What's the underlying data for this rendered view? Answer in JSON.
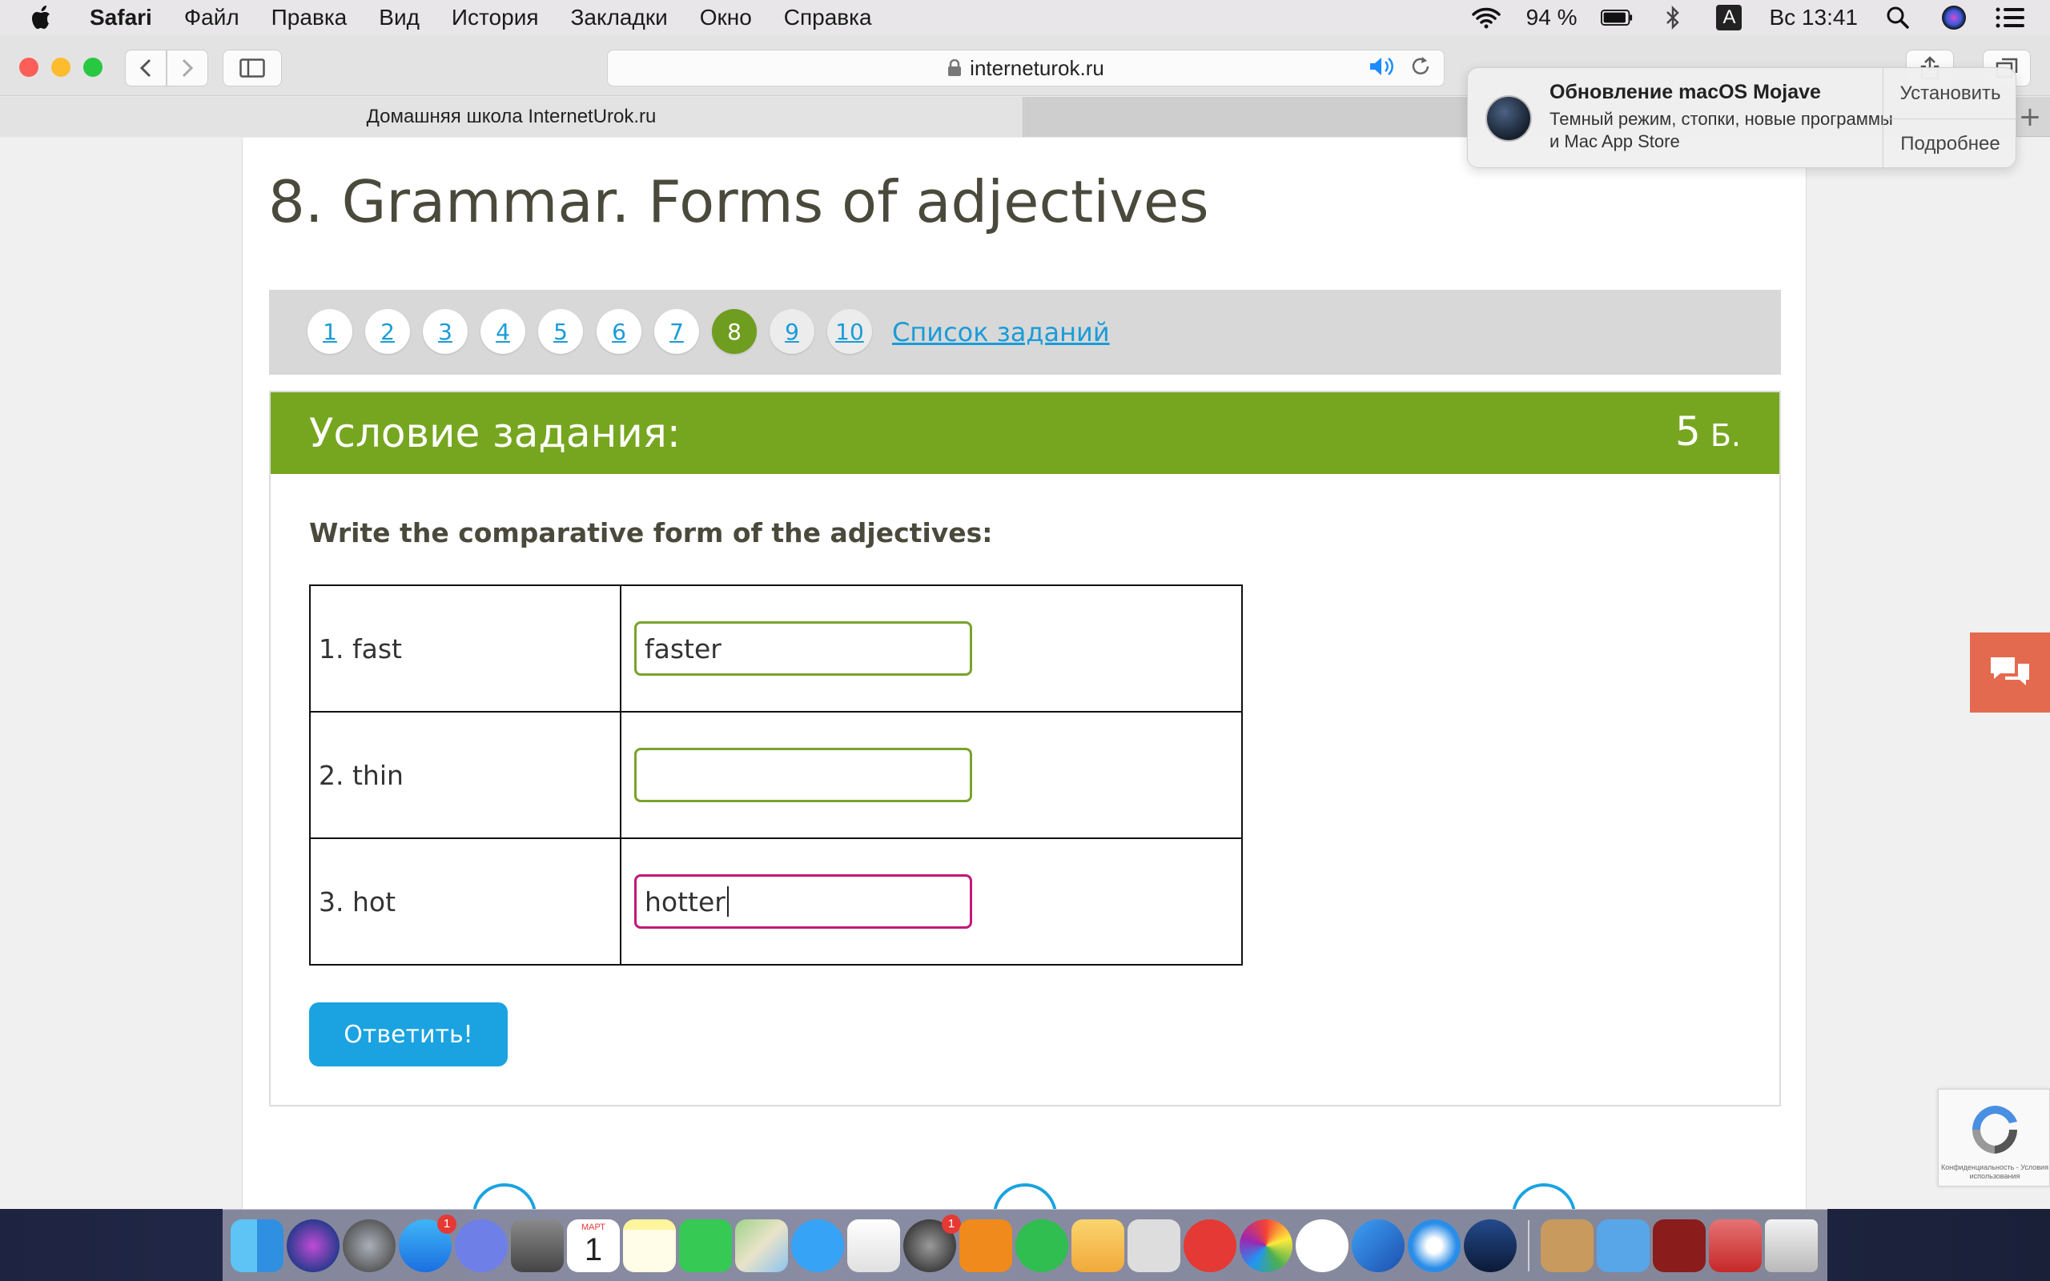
{
  "menubar": {
    "app_name": "Safari",
    "items": [
      "Файл",
      "Правка",
      "Вид",
      "История",
      "Закладки",
      "Окно",
      "Справка"
    ],
    "battery": "94 %",
    "input_source": "A",
    "clock": "Вс 13:41"
  },
  "browser": {
    "url": "interneturok.ru",
    "tabs": [
      {
        "label": "Домашняя школа InternetUrok.ru",
        "active": true
      },
      {
        "label": "",
        "active": false
      }
    ]
  },
  "page": {
    "title": "8. Grammar. Forms of adjectives",
    "task_nav": {
      "numbers": [
        "1",
        "2",
        "3",
        "4",
        "5",
        "6",
        "7",
        "8",
        "9",
        "10"
      ],
      "active": "8",
      "list_link": "Список заданий"
    },
    "task": {
      "header": "Условие задания:",
      "points_value": "5",
      "points_unit": "Б.",
      "instruction": "Write the comparative form of the adjectives:",
      "rows": [
        {
          "word": "1. fast",
          "answer": "faster"
        },
        {
          "word": "2. thin",
          "answer": ""
        },
        {
          "word": "3. hot",
          "answer": "hotter"
        }
      ],
      "submit_label": "Ответить!"
    },
    "recaptcha_text": "Конфиденциальность - Условия использования"
  },
  "notification": {
    "title": "Обновление macOS Mojave",
    "body": "Темный режим, стопки, новые программы и Mac App Store",
    "actions": [
      "Установить",
      "Подробнее"
    ]
  },
  "dock": {
    "calendar_month": "МАРТ",
    "calendar_day": "1",
    "badge_app_store": "1",
    "badge_system_prefs": "1"
  },
  "colors": {
    "accent_green": "#76a620",
    "link_blue": "#1aa3e0",
    "focus_pink": "#c2187a",
    "chat_orange": "#e46a4f"
  }
}
